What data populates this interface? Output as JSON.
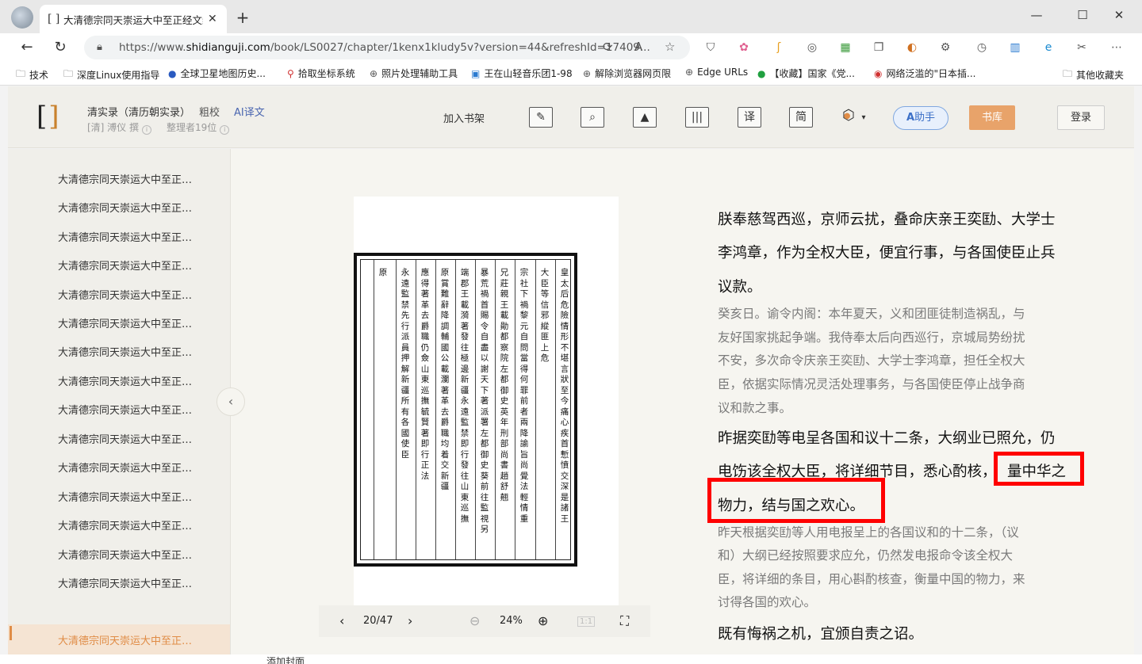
{
  "browser": {
    "tab_title": "大清德宗同天崇运大中至正经文纬",
    "tab_favicon": "[ ]",
    "url_prefix": "https://www.",
    "url_domain": "shidianguji.com",
    "url_rest": "/book/LS0027/chapter/1kenx1kludy5v?version=44&refreshId=17409..."
  },
  "bookmarks": [
    {
      "label": "技术",
      "icon": "folder-icon"
    },
    {
      "label": "深度Linux使用指导",
      "icon": "folder-icon"
    },
    {
      "label": "全球卫星地图历史...",
      "icon": "globe-icon"
    },
    {
      "label": "拾取坐标系统",
      "icon": "pin-icon"
    },
    {
      "label": "照片处理辅助工具",
      "icon": "globe-icon"
    },
    {
      "label": "王在山轻音乐团1-98",
      "icon": "tv-icon"
    },
    {
      "label": "解除浏览器网页限",
      "icon": "globe-icon"
    },
    {
      "label": "Edge URLs",
      "icon": "globe-icon"
    },
    {
      "label": "【收藏】国家《党...",
      "icon": "chat-icon"
    },
    {
      "label": "网络泛滥的\"日本插...",
      "icon": "flag-icon"
    },
    {
      "label": "其他收藏夹",
      "icon": "folder-icon"
    }
  ],
  "site": {
    "book_title": "清实录（清历朝实录）",
    "link_coarse": "粗校",
    "link_ai": "AI译文",
    "author": "[清] 溥仪 撰",
    "organizer": "整理者19位",
    "add_shelf": "加入书架",
    "tools": [
      "✎",
      "⌕",
      "▲",
      "|||",
      "译",
      "简"
    ],
    "ai_assistant": "助手",
    "library": "书库",
    "login": "登录"
  },
  "sidebar": {
    "chapters": [
      "大清德宗同天崇运大中至正…",
      "大清德宗同天崇运大中至正…",
      "大清德宗同天崇运大中至正…",
      "大清德宗同天崇运大中至正…",
      "大清德宗同天崇运大中至正…",
      "大清德宗同天崇运大中至正…",
      "大清德宗同天崇运大中至正…",
      "大清德宗同天崇运大中至正…",
      "大清德宗同天崇运大中至正…",
      "大清德宗同天崇运大中至正…",
      "大清德宗同天崇运大中至正…",
      "大清德宗同天崇运大中至正…",
      "大清德宗同天崇运大中至正…",
      "大清德宗同天崇运大中至正…",
      "大清德宗同天崇运大中至正…",
      "大清德宗同天崇运大中至正…"
    ]
  },
  "scan": {
    "columns": [
      "皇太后危險情形不堪言狀至今痛心疾首慙憤交深是諸王",
      "大臣等信邪縱匪上危",
      "宗社下禍黎元自問當得何罪前者兩降諭旨尚覺法輕情重",
      "兄莊親王載勛都察院左都御史英年刑部尚書趙舒翹",
      "暴荒禍首賜令自盡以謝天下著派署左都御史葵前往監視另",
      "端郡王載漪著發往極邊新疆永遠監禁即行發往山東巡撫",
      "原賞難辭降調輔國公載瀾著革去爵職均着交新疆",
      "應得著革去爵職仍僉山東巡撫毓賢著即行正法",
      "永遠監禁先行派員押解新疆所有各國使臣",
      "原"
    ],
    "page": "20/47",
    "zoom": "24%"
  },
  "text": {
    "p1_l1": "朕奉慈驾西巡，京师云扰，叠命庆亲王奕劻、大学士",
    "p1_l2": "李鸿章，作为全权大臣，便宜行事，与各国使臣止兵",
    "p1_l3": "议款。",
    "t1_l1": "癸亥日。谕令内阁：本年夏天，义和团匪徒制造祸乱，与",
    "t1_l2": "友好国家挑起争端。我侍奉太后向西巡行，京城局势纷扰",
    "t1_l3": "不安，多次命令庆亲王奕劻、大学士李鸿章，担任全权大",
    "t1_l4": "臣，依据实际情况灵活处理事务，与各国使臣停止战争商",
    "t1_l5": "议和款之事。",
    "p2_l1": "昨据奕劻等电呈各国和议十二条，大纲业已照允，仍",
    "p2_l2a": "电饬该全权大臣，将详细节目，悉心酌核，",
    "p2_l2b": "量中华之",
    "p2_l3": "物力，结与国之欢心。",
    "t2_l1": "昨天根据奕劻等人用电报呈上的各国议和的十二条，（议",
    "t2_l2": "和）大纲已经按照要求应允，仍然发电报命令该全权大",
    "t2_l3": "臣，将详细的条目，用心斟酌核查，衡量中国的物力，来",
    "t2_l4": "讨得各国的欢心。",
    "p3_l1": "既有悔祸之机，宜颁自责之诏。",
    "bottom": "添加封面"
  }
}
